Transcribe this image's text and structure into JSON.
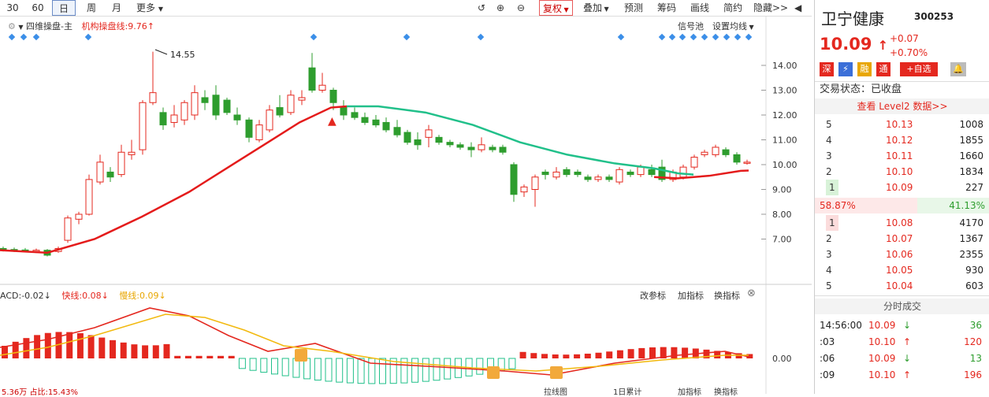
{
  "toolbar": {
    "periods": [
      "30",
      "60",
      "日",
      "周",
      "月",
      "更多"
    ],
    "actions": [
      "复权",
      "叠加",
      "预测",
      "筹码",
      "画线",
      "简约",
      "隐藏>>"
    ]
  },
  "main_chart": {
    "indicator_title": "四维操盘-主",
    "indicator_value": "机构操盘线:9.76",
    "signal_pool": "信号池",
    "setup_ma": "设置均线",
    "max_label": "14.55",
    "y_ticks": [
      "14.00",
      "13.00",
      "12.00",
      "11.00",
      "10.00",
      "9.00",
      "8.00",
      "7.00"
    ]
  },
  "sub_chart": {
    "macd_label": "ACD:-0.02",
    "fast_label": "快线:0.08",
    "slow_label": "慢线:0.09",
    "btn_change": "改参标",
    "btn_add": "加指标",
    "btn_swap": "换指标",
    "zero_label": "0.00",
    "bottom_left": "5.36万  占比:15.43%",
    "bottom_btns": [
      "拉线图",
      "1日累计",
      "加指标",
      "换指标"
    ]
  },
  "colors": {
    "up": "#e4281f",
    "down": "#2e9d2e",
    "slow": "#f2b90f",
    "fast": "#e4281f",
    "ma_green": "#21c08a"
  },
  "stock": {
    "name": "卫宁健康",
    "code": "300253",
    "price": "10.09",
    "change": "+0.07",
    "change_pct": "+0.70%",
    "tags": [
      "深",
      "融",
      "通",
      "+自选"
    ],
    "trade_status": "交易状态：已收盘",
    "level2": "查看 Level2 数据>>",
    "asks": [
      {
        "level": "5",
        "price": "10.13",
        "vol": "1008"
      },
      {
        "level": "4",
        "price": "10.12",
        "vol": "1855"
      },
      {
        "level": "3",
        "price": "10.11",
        "vol": "1660"
      },
      {
        "level": "2",
        "price": "10.10",
        "vol": "1834"
      },
      {
        "level": "1",
        "price": "10.09",
        "vol": "227"
      }
    ],
    "weibi_left": "58.87%",
    "weibi_right": "41.13%",
    "bids": [
      {
        "level": "1",
        "price": "10.08",
        "vol": "4170"
      },
      {
        "level": "2",
        "price": "10.07",
        "vol": "1367"
      },
      {
        "level": "3",
        "price": "10.06",
        "vol": "2355"
      },
      {
        "level": "4",
        "price": "10.05",
        "vol": "930"
      },
      {
        "level": "5",
        "price": "10.04",
        "vol": "603"
      }
    ],
    "ticks_title": "分时成交",
    "ticks": [
      {
        "time": "14:56:00",
        "price": "10.09",
        "dir": "down",
        "vol": "36"
      },
      {
        "time": ":03",
        "price": "10.10",
        "dir": "up",
        "vol": "120"
      },
      {
        "time": ":06",
        "price": "10.09",
        "dir": "down",
        "vol": "13"
      },
      {
        "time": ":09",
        "price": "10.10",
        "dir": "up",
        "vol": "196"
      }
    ]
  }
}
